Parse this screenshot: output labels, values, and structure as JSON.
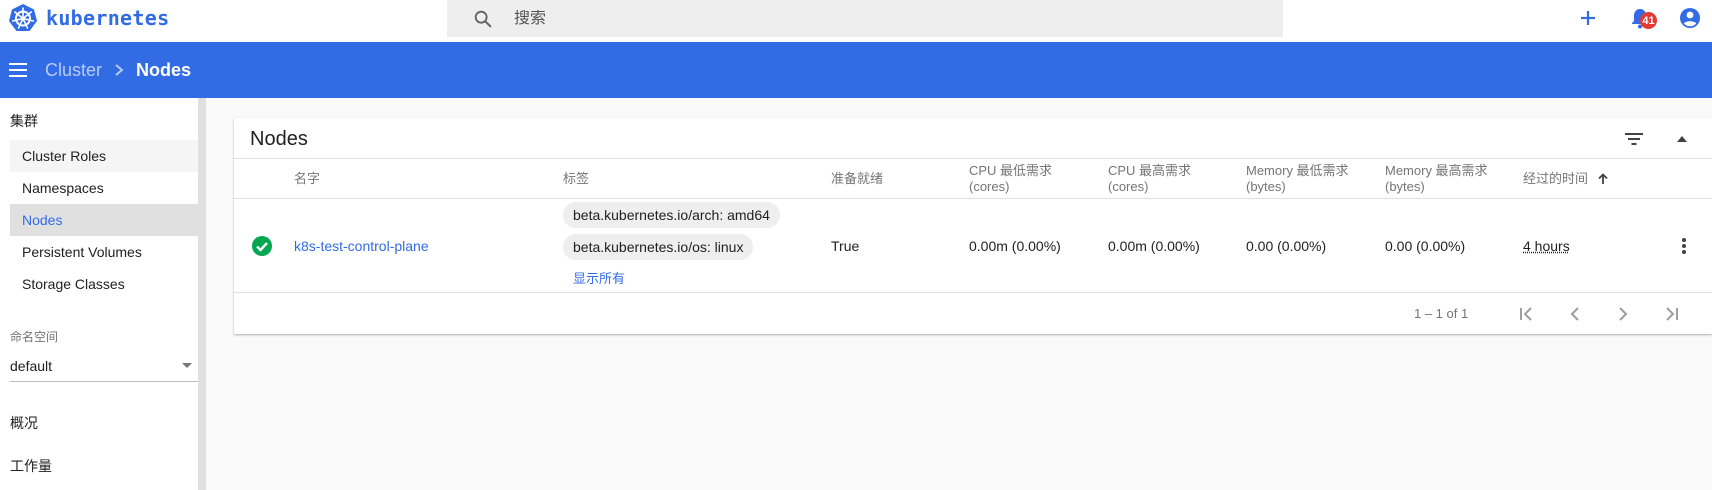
{
  "brand": {
    "name": "kubernetes",
    "logo_icon": "kubernetes-wheel-icon",
    "color": "#326ce5"
  },
  "search": {
    "placeholder": "搜索",
    "value": ""
  },
  "top_actions": {
    "create_icon": "plus-icon",
    "notifications_icon": "bell-icon",
    "notification_count": "41",
    "account_icon": "account-circle-icon"
  },
  "toolbar": {
    "menu_icon": "hamburger-menu-icon",
    "breadcrumb_parent": "Cluster",
    "breadcrumb_current": "Nodes"
  },
  "sidebar": {
    "cluster_heading": "集群",
    "items": [
      {
        "label": "Cluster Roles"
      },
      {
        "label": "Namespaces"
      },
      {
        "label": "Nodes",
        "active": true
      },
      {
        "label": "Persistent Volumes"
      },
      {
        "label": "Storage Classes"
      }
    ],
    "namespace_label": "命名空间",
    "namespace_value": "default",
    "overview": "概况",
    "workloads": "工作量"
  },
  "card": {
    "title": "Nodes",
    "filter_icon": "filter-list-icon",
    "collapse_icon": "arrow-up-icon",
    "columns": {
      "name": "名字",
      "labels": "标签",
      "ready": "准备就绪",
      "cpu_req_1": "CPU 最低需求",
      "cpu_req_2": "(cores)",
      "cpu_lim_1": "CPU 最高需求",
      "cpu_lim_2": "(cores)",
      "mem_req_1": "Memory 最低需求",
      "mem_req_2": "(bytes)",
      "mem_lim_1": "Memory 最高需求",
      "mem_lim_2": "(bytes)",
      "age": "经过的时间"
    },
    "rows": [
      {
        "status_icon": "check-circle-icon",
        "name": "k8s-test-control-plane",
        "labels": [
          "beta.kubernetes.io/arch: amd64",
          "beta.kubernetes.io/os: linux"
        ],
        "show_all": "显示所有",
        "ready": "True",
        "cpu_requests": "0.00m (0.00%)",
        "cpu_limits": "0.00m (0.00%)",
        "memory_requests": "0.00 (0.00%)",
        "memory_limits": "0.00 (0.00%)",
        "age": "4 hours"
      }
    ],
    "pagination": {
      "range": "1 – 1 of 1"
    }
  }
}
